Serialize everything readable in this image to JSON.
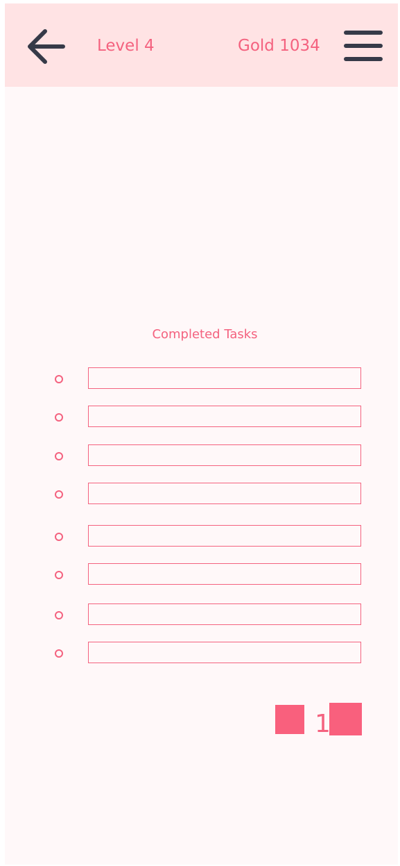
{
  "header": {
    "back_icon": "arrow-left-icon",
    "level_label": "Level 4",
    "gold_label": "Gold 1034",
    "menu_icon": "hamburger-menu-icon"
  },
  "completed_tasks": {
    "title": "Completed Tasks",
    "items": [
      {
        "value": ""
      },
      {
        "value": ""
      },
      {
        "value": ""
      },
      {
        "value": ""
      },
      {
        "value": ""
      },
      {
        "value": ""
      },
      {
        "value": ""
      },
      {
        "value": ""
      }
    ]
  },
  "pagination": {
    "current_page": "1"
  },
  "colors": {
    "accent": "#f4627f",
    "header_bg": "#ffe3e4",
    "page_bg": "#fff8f9",
    "icon_dark": "#363a48"
  }
}
